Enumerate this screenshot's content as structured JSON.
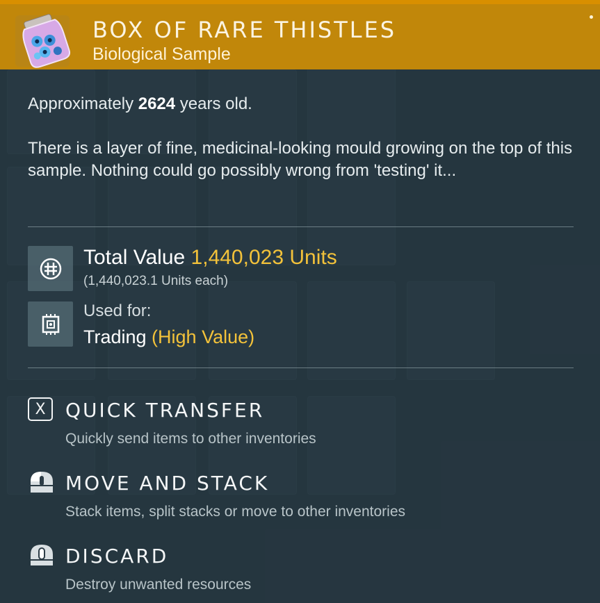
{
  "item": {
    "title": "BOX OF RARE THISTLES",
    "subtitle": "Biological Sample",
    "age_prefix": "Approximately ",
    "age_value": "2624",
    "age_suffix": " years old.",
    "description": "There is a layer of fine, medicinal-looking mould growing on the top of this sample. Nothing could go possibly wrong from 'testing' it..."
  },
  "value": {
    "label": "Total Value ",
    "amount": "1,440,023 Units",
    "each": "(1,440,023.1 Units each)"
  },
  "usage": {
    "label": "Used for:",
    "value": "Trading ",
    "highlight": "(High Value)"
  },
  "actions": [
    {
      "title": "QUICK TRANSFER",
      "desc": "Quickly send items to other inventories",
      "icon": "x-key-icon"
    },
    {
      "title": "MOVE AND STACK",
      "desc": "Stack items, split stacks or move to other inventories",
      "icon": "mouse-left-click-icon"
    },
    {
      "title": "DISCARD",
      "desc": "Destroy unwanted resources",
      "icon": "mouse-middle-click-icon"
    }
  ],
  "colors": {
    "header": "#c1870a",
    "accent": "#f3c23a",
    "panel": "#2c3c46"
  }
}
